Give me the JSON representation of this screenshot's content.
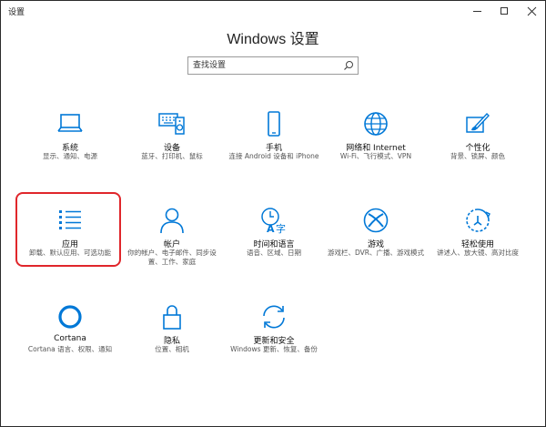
{
  "window": {
    "title": "设置",
    "controls": {
      "minimize": "minimize-icon",
      "maximize": "maximize-icon",
      "close": "close-icon"
    }
  },
  "header": {
    "title": "Windows 设置"
  },
  "search": {
    "placeholder": "查找设置",
    "icon": "search-icon"
  },
  "colors": {
    "accent": "#0078d7",
    "highlight": "#e0262b"
  },
  "tiles": [
    {
      "id": "system",
      "icon": "laptop-icon",
      "title": "系统",
      "desc": "显示、通知、电源"
    },
    {
      "id": "devices",
      "icon": "keyboard-speaker-icon",
      "title": "设备",
      "desc": "蓝牙、打印机、鼠标"
    },
    {
      "id": "phone",
      "icon": "phone-icon",
      "title": "手机",
      "desc": "连接 Android 设备和 iPhone"
    },
    {
      "id": "network",
      "icon": "globe-icon",
      "title": "网络和 Internet",
      "desc": "Wi-Fi、飞行模式、VPN"
    },
    {
      "id": "personalization",
      "icon": "paint-icon",
      "title": "个性化",
      "desc": "背景、锁屏、颜色"
    },
    {
      "id": "apps",
      "icon": "apps-list-icon",
      "title": "应用",
      "desc": "卸载、默认应用、可选功能"
    },
    {
      "id": "accounts",
      "icon": "person-icon",
      "title": "帐户",
      "desc": "你的帐户、电子邮件、同步设置、工作、家庭"
    },
    {
      "id": "time-language",
      "icon": "time-language-icon",
      "title": "时间和语言",
      "desc": "语音、区域、日期"
    },
    {
      "id": "gaming",
      "icon": "xbox-icon",
      "title": "游戏",
      "desc": "游戏栏、DVR、广播、游戏模式"
    },
    {
      "id": "ease-of-access",
      "icon": "ease-of-access-icon",
      "title": "轻松使用",
      "desc": "讲述人、放大镜、高对比度"
    },
    {
      "id": "cortana",
      "icon": "cortana-icon",
      "title": "Cortana",
      "desc": "Cortana 语言、权限、通知"
    },
    {
      "id": "privacy",
      "icon": "lock-icon",
      "title": "隐私",
      "desc": "位置、相机"
    },
    {
      "id": "update-security",
      "icon": "sync-icon",
      "title": "更新和安全",
      "desc": "Windows 更新、恢复、备份"
    }
  ]
}
